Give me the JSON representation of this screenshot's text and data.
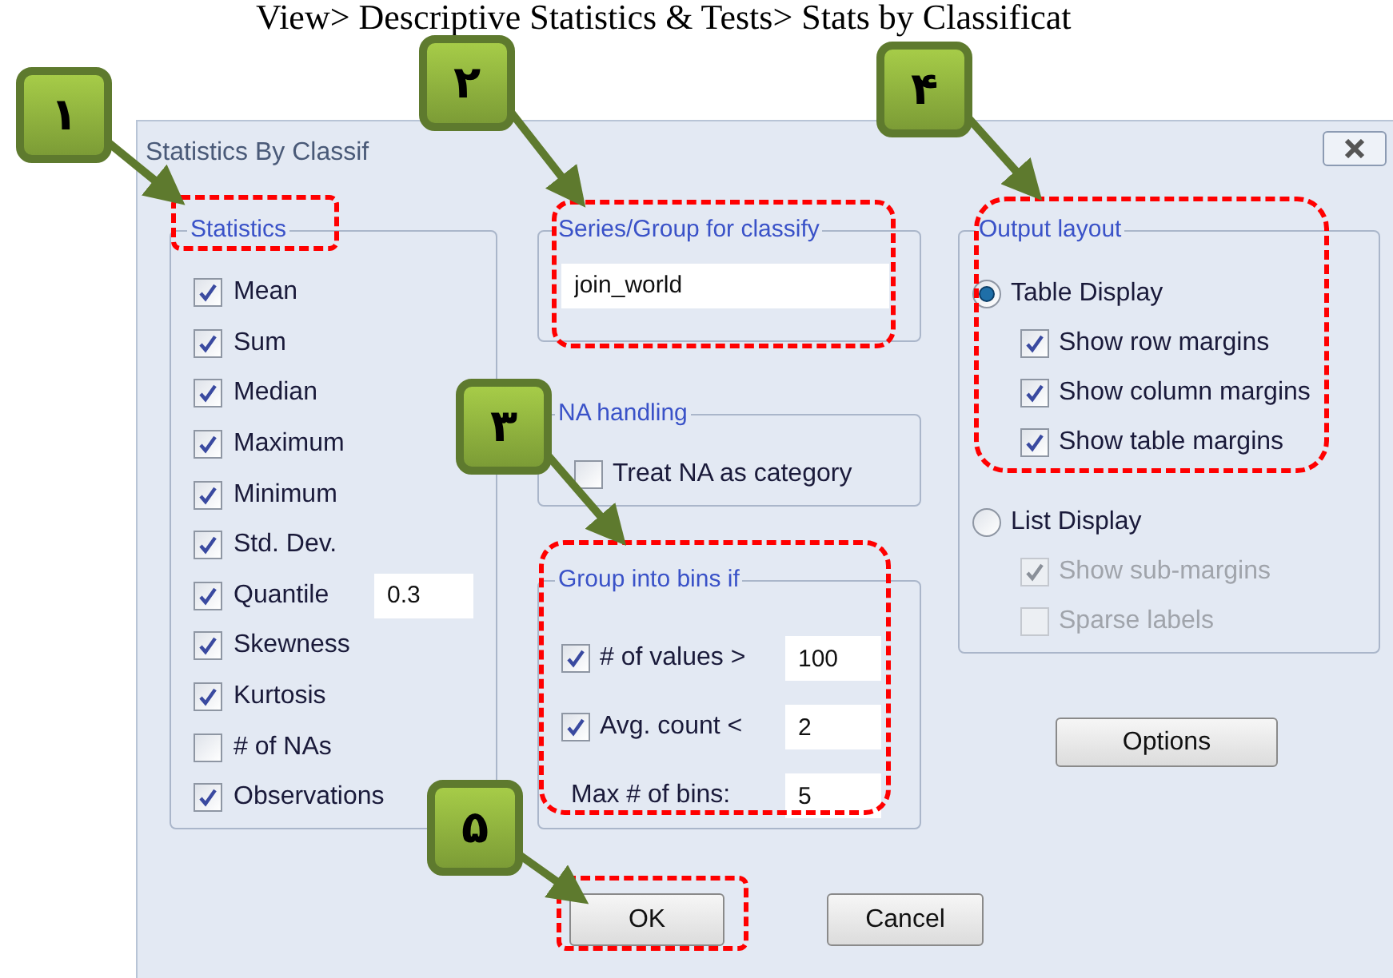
{
  "document_text": "View> Descriptive Statistics & Tests> Stats by Classificat",
  "dialog": {
    "title": "Statistics By Classif"
  },
  "statistics": {
    "label": "Statistics",
    "items": [
      {
        "label": "Mean",
        "checked": true
      },
      {
        "label": "Sum",
        "checked": true
      },
      {
        "label": "Median",
        "checked": true
      },
      {
        "label": "Maximum",
        "checked": true
      },
      {
        "label": "Minimum",
        "checked": true
      },
      {
        "label": "Std. Dev.",
        "checked": true
      },
      {
        "label": "Quantile",
        "checked": true,
        "value": "0.3"
      },
      {
        "label": "Skewness",
        "checked": true
      },
      {
        "label": "Kurtosis",
        "checked": true
      },
      {
        "label": "# of NAs",
        "checked": false
      },
      {
        "label": "Observations",
        "checked": true
      }
    ]
  },
  "series_group": {
    "label": "Series/Group for classify",
    "value": "join_world"
  },
  "na_handling": {
    "label": "NA handling",
    "items": [
      {
        "label": "Treat NA as category",
        "checked": false
      }
    ]
  },
  "group_into_bins": {
    "label": "Group into bins if",
    "rows": [
      {
        "kind": "checkbox",
        "label": "# of values >",
        "checked": true,
        "value": "100"
      },
      {
        "kind": "checkbox",
        "label": "Avg. count <",
        "checked": true,
        "value": "2"
      },
      {
        "kind": "plain",
        "label": "Max # of bins:",
        "value": "5"
      }
    ]
  },
  "output_layout": {
    "label": "Output layout",
    "options": [
      {
        "label": "Table Display",
        "selected": true,
        "suboptions": [
          {
            "label": "Show row margins",
            "checked": true,
            "disabled": false
          },
          {
            "label": "Show column margins",
            "checked": true,
            "disabled": false
          },
          {
            "label": "Show table margins",
            "checked": true,
            "disabled": false
          }
        ]
      },
      {
        "label": "List Display",
        "selected": false,
        "suboptions": [
          {
            "label": "Show sub-margins",
            "checked": true,
            "disabled": true
          },
          {
            "label": "Sparse labels",
            "checked": false,
            "disabled": true
          }
        ]
      }
    ]
  },
  "options_button": "Options",
  "ok_button": "OK",
  "cancel_button": "Cancel",
  "callouts": [
    {
      "label": "۱"
    },
    {
      "label": "۲"
    },
    {
      "label": "۳"
    },
    {
      "label": "۴"
    },
    {
      "label": "۵"
    }
  ]
}
